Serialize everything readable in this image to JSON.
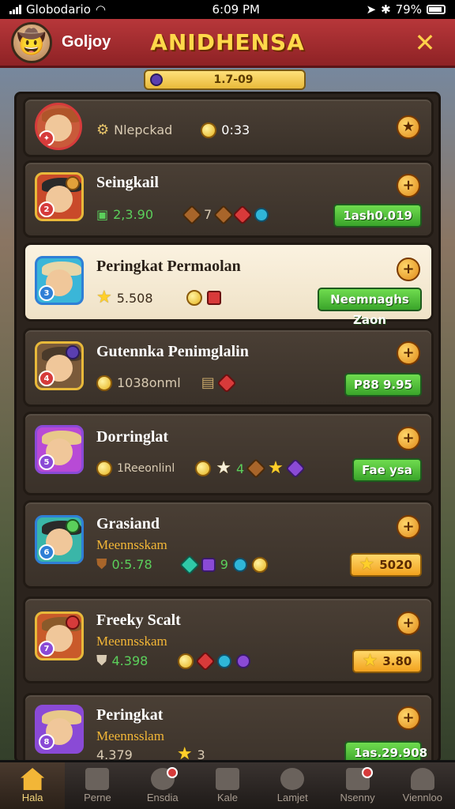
{
  "status_bar": {
    "carrier": "Globodario",
    "time": "6:09 PM",
    "battery": "79%"
  },
  "header": {
    "username": "Goljoy",
    "title": "ANIDHENSA"
  },
  "currency": {
    "value": "1.7-09"
  },
  "cards": [
    {
      "name": "Nlepckad",
      "sub": "",
      "stat": "0:33",
      "button": "",
      "button_type": ""
    },
    {
      "name": "Seingkail",
      "sub": "",
      "stat": "2,3.90",
      "stat2": "7",
      "button": "1ash0.019",
      "button_type": "green"
    },
    {
      "name": "Peringkat Permaolan",
      "sub": "",
      "stat": "5.508",
      "button": "Neemnaghs Zaon",
      "button_type": "green"
    },
    {
      "name": "Gutennka Penimglalin",
      "sub": "",
      "stat": "1038onml",
      "button": "P88 9.95",
      "button_type": "green"
    },
    {
      "name": "Dorringlat",
      "sub": "",
      "stat": "1Reeonlinl",
      "stat2": "4",
      "button": "Fae ysa",
      "button_type": "green"
    },
    {
      "name": "Grasiand",
      "sub": "Meennsskam",
      "stat": "0:5.78",
      "stat2": "9",
      "button": "5020",
      "button_type": "gold"
    },
    {
      "name": "Freeky Scalt",
      "sub": "Meennsskam",
      "stat": "4.398",
      "button": "3.80",
      "button_type": "gold"
    },
    {
      "name": "Peringkat",
      "sub": "Meennsslam",
      "stat": "4.379",
      "stat2": "3",
      "button": "1as.29.908",
      "button_type": "green"
    }
  ],
  "tabs": [
    {
      "label": "Hala",
      "icon": "home-icon",
      "active": true
    },
    {
      "label": "Perne",
      "icon": "map-icon"
    },
    {
      "label": "Ensdia",
      "icon": "team-icon"
    },
    {
      "label": "Kale",
      "icon": "shop-icon"
    },
    {
      "label": "Lamjet",
      "icon": "timer-icon"
    },
    {
      "label": "Nsenny",
      "icon": "news-icon"
    },
    {
      "label": "Viennloo",
      "icon": "profile-icon"
    }
  ]
}
